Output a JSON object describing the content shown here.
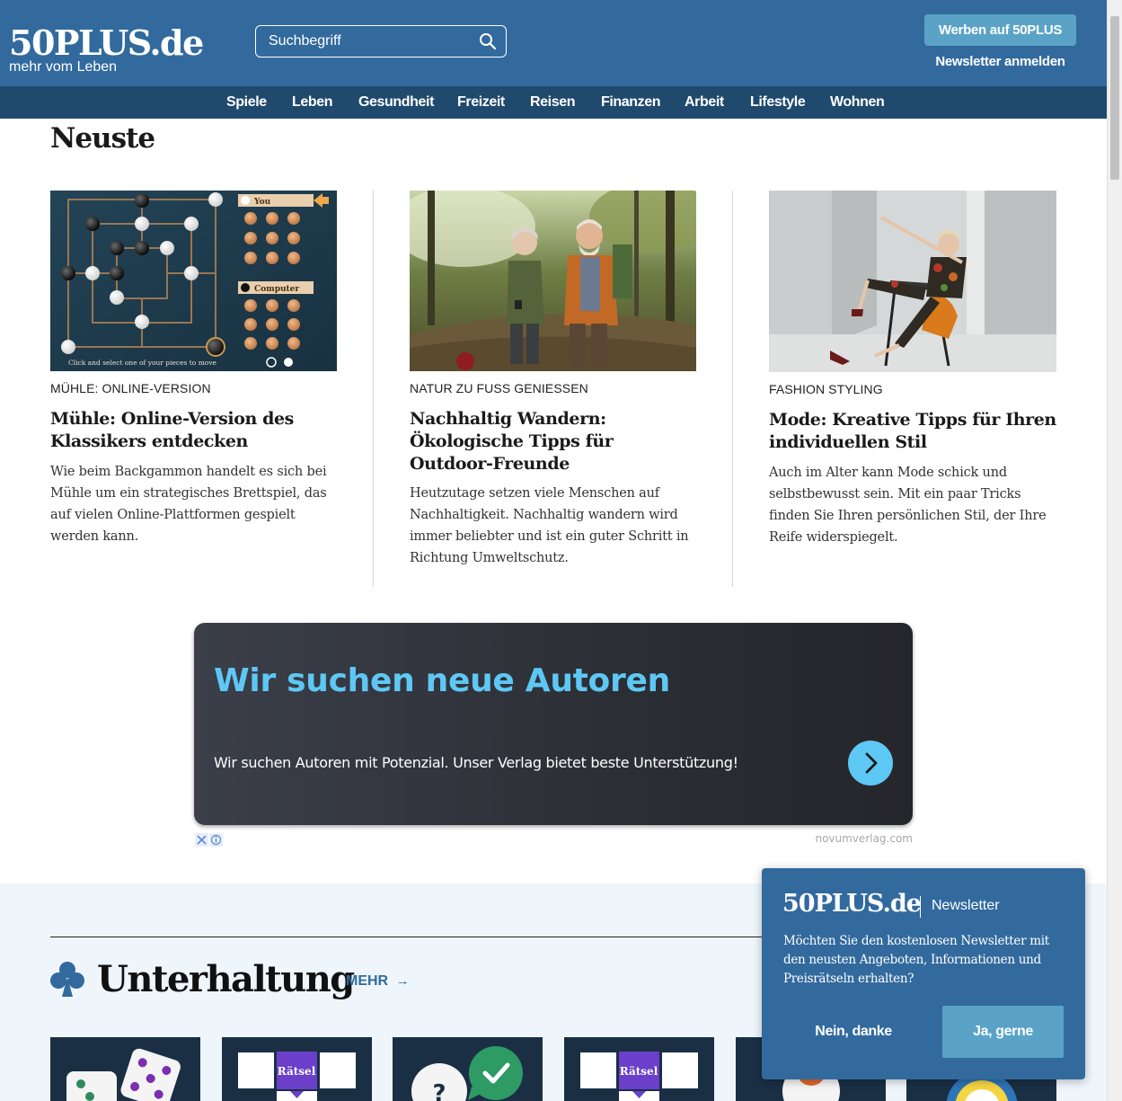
{
  "header": {
    "logo_main": "50PLUS.de",
    "logo_sub": "mehr vom Leben",
    "search_placeholder": "Suchbegriff",
    "werben_label": "Werben auf 50PLUS",
    "newsletter_label": "Newsletter anmelden"
  },
  "nav": {
    "items": [
      "Spiele",
      "Leben",
      "Gesundheit",
      "Freizeit",
      "Reisen",
      "Finanzen",
      "Arbeit",
      "Lifestyle",
      "Wohnen"
    ]
  },
  "neuste": {
    "title": "Neuste",
    "articles": [
      {
        "kicker": "Mühle: Online-Version",
        "title": "Mühle: Online-Version des Klassikers entdecken",
        "text": "Wie beim Backgammon handelt es sich bei Mühle um ein strategisches Brettspiel, das auf vielen Online-Plattformen gespielt werden kann.",
        "image": {
          "you_label": "You",
          "computer_label": "Computer",
          "hint": "Click and select one of your pieces to move"
        }
      },
      {
        "kicker": "Natur zu Fuß genießen",
        "title": "Nachhaltig Wandern: Ökologische Tipps für Outdoor-Freunde",
        "text": "Heutzutage setzen viele Menschen auf Nachhaltigkeit. Nachhaltig wandern wird immer beliebter und ist ein guter Schritt in Richtung Umweltschutz."
      },
      {
        "kicker": "Fashion Styling",
        "title": "Mode: Kreative Tipps für Ihren individuellen Stil",
        "text": "Auch im Alter kann Mode schick und selbstbewusst sein. Mit ein paar Tricks finden Sie Ihren persönlichen Stil, der Ihre Reife widerspiegelt."
      }
    ]
  },
  "ad": {
    "title": "Wir suchen neue Autoren",
    "text": "Wir suchen Autoren mit Potenzial. Unser Verlag bietet beste Unterstützung!",
    "source": "novumverlag.com"
  },
  "entertainment": {
    "title": "Unterhaltung",
    "more_label": "MEHR",
    "tile_raetsel_label": "Rätsel",
    "tile_question_label": "?"
  },
  "newsletter_popup": {
    "logo": "50PLUS.de",
    "label": "Newsletter",
    "text": "Möchten Sie den kostenlosen Newsletter mit den neusten Angeboten, Informationen und Preisrätseln erhalten?",
    "no_label": "Nein, danke",
    "yes_label": "Ja, gerne"
  },
  "colors": {
    "header_blue": "#326a9e",
    "nav_dark": "#1f4a6e",
    "accent_light_blue": "#5aa3c7",
    "ad_cyan": "#5ec8f5"
  }
}
